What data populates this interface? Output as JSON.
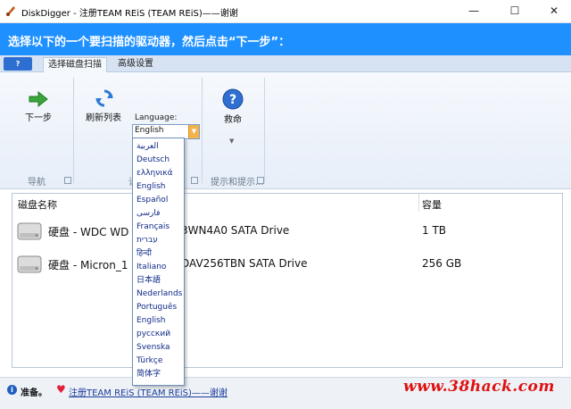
{
  "window": {
    "title": "DiskDigger - 注册TEAM REiS (TEAM REiS)——谢谢",
    "min_glyph": "—",
    "max_glyph": "☐",
    "close_glyph": "✕",
    "app_icon": "diskdigger-icon"
  },
  "banner": {
    "text": "选择以下的一个要扫描的驱动器，然后点击“下一步”："
  },
  "tabs": {
    "help_label": "?",
    "items": [
      {
        "label": "选择磁盘扫描",
        "active": true
      },
      {
        "label": "高级设置",
        "active": false
      }
    ]
  },
  "ribbon": {
    "next_label": "下一步",
    "refresh_label": "刷新列表",
    "language_label": "Language:",
    "language_value": "English",
    "rescue_label": "救命",
    "groups": {
      "nav": "导航",
      "settings_fragment": "设",
      "tips": "提示和提示..."
    }
  },
  "table": {
    "headers": {
      "name": "磁盘名称",
      "size": "容量"
    },
    "rows": [
      {
        "name_left": "硬盘 - WDC WD",
        "name_right": "3WN4A0 SATA Drive",
        "size": "1 TB"
      },
      {
        "name_left": "硬盘 - Micron_1",
        "name_right": "DAV256TBN SATA Drive",
        "size": "256 GB"
      }
    ]
  },
  "language_dropdown": {
    "options": [
      "العربية",
      "Deutsch",
      "ελληνικά",
      "English",
      "Español",
      "فارسی",
      "Français",
      "עברית",
      "हिन्दी",
      "Italiano",
      "日本語",
      "Nederlands",
      "Português",
      "English",
      "русский",
      "Svenska",
      "Türkçe",
      "简体字"
    ]
  },
  "status": {
    "ready": "准备。",
    "link": "注册TEAM REiS (TEAM REiS)——谢谢",
    "watermark": "www.38hack.com"
  },
  "colors": {
    "banner": "#1e90ff",
    "help_tab": "#2d6fd1",
    "watermark": "#e01010"
  }
}
